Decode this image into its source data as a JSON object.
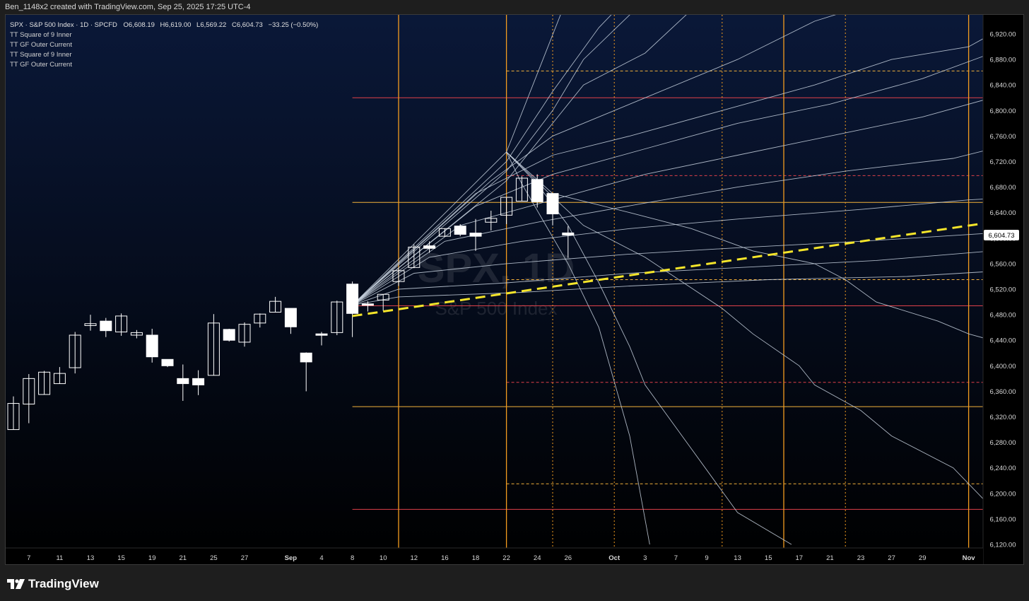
{
  "header": {
    "title": "Ben_1148x2 created with TradingView.com, Sep 25, 2025 17:25 UTC-4"
  },
  "legend": {
    "symbol": "SPX · S&P 500 Index · 1D · SPCFD",
    "open_label": "O",
    "open": "6,608.19",
    "high_label": "H",
    "high": "6,619.00",
    "low_label": "L",
    "low": "6,569.22",
    "close_label": "C",
    "close": "6,604.73",
    "change": "−33.25 (−0.50%)",
    "indicators": [
      "TT Square of 9 Inner",
      "TT GF Outer Current",
      "TT Square of 9 Inner",
      "TT GF Outer Current"
    ]
  },
  "watermark": {
    "symbol": "SPX, 1D",
    "name": "S&P 500 Index"
  },
  "price_badge": "6,604.73",
  "brand": {
    "name": "TradingView",
    "icon": "tradingview-logo-icon"
  },
  "colors": {
    "background_top": "#0a1838",
    "background_bottom": "#000000",
    "candle": "#ffffff",
    "gann_fan": "#c9d3e0",
    "trend_line": "#f5e52a",
    "vline": "#f39c1f",
    "red_level": "#e0414a",
    "orange_level": "#f2b13a"
  },
  "chart_data": {
    "type": "candlestick",
    "y_axis": {
      "min": 6120,
      "max": 6940,
      "ticks": [
        "6,920.00",
        "6,880.00",
        "6,840.00",
        "6,800.00",
        "6,760.00",
        "6,720.00",
        "6,680.00",
        "6,640.00",
        "6,600.00",
        "6,560.00",
        "6,520.00",
        "6,480.00",
        "6,440.00",
        "6,400.00",
        "6,360.00",
        "6,320.00",
        "6,280.00",
        "6,240.00",
        "6,200.00",
        "6,160.00",
        "6,120.00"
      ]
    },
    "x_axis": {
      "labels": [
        {
          "label": "7",
          "i": 1
        },
        {
          "label": "11",
          "i": 3
        },
        {
          "label": "13",
          "i": 5
        },
        {
          "label": "15",
          "i": 7
        },
        {
          "label": "19",
          "i": 9
        },
        {
          "label": "21",
          "i": 11
        },
        {
          "label": "25",
          "i": 13
        },
        {
          "label": "27",
          "i": 15
        },
        {
          "label": "Sep",
          "i": 18
        },
        {
          "label": "4",
          "i": 20
        },
        {
          "label": "8",
          "i": 22
        },
        {
          "label": "10",
          "i": 24
        },
        {
          "label": "12",
          "i": 26
        },
        {
          "label": "16",
          "i": 28
        },
        {
          "label": "18",
          "i": 30
        },
        {
          "label": "22",
          "i": 32
        },
        {
          "label": "24",
          "i": 34
        },
        {
          "label": "26",
          "i": 36
        },
        {
          "label": "Oct",
          "i": 39
        },
        {
          "label": "3",
          "i": 41
        },
        {
          "label": "7",
          "i": 43
        },
        {
          "label": "9",
          "i": 45
        },
        {
          "label": "13",
          "i": 47
        },
        {
          "label": "15",
          "i": 49
        },
        {
          "label": "17",
          "i": 51
        },
        {
          "label": "21",
          "i": 53
        },
        {
          "label": "23",
          "i": 55
        },
        {
          "label": "27",
          "i": 57
        },
        {
          "label": "29",
          "i": 59
        },
        {
          "label": "Nov",
          "i": 62
        }
      ]
    },
    "candles": [
      {
        "d": "Aug 5",
        "o": 6300,
        "h": 6352,
        "l": 6300,
        "c": 6341
      },
      {
        "d": "Aug 6",
        "o": 6340,
        "h": 6387,
        "l": 6310,
        "c": 6380
      },
      {
        "d": "Aug 7",
        "o": 6355,
        "h": 6392,
        "l": 6355,
        "c": 6390
      },
      {
        "d": "Aug 8",
        "o": 6372,
        "h": 6398,
        "l": 6372,
        "c": 6388
      },
      {
        "d": "Aug 11",
        "o": 6397,
        "h": 6453,
        "l": 6388,
        "c": 6448
      },
      {
        "d": "Aug 12",
        "o": 6463,
        "h": 6480,
        "l": 6455,
        "c": 6466
      },
      {
        "d": "Aug 13",
        "o": 6470,
        "h": 6475,
        "l": 6445,
        "c": 6455
      },
      {
        "d": "Aug 14",
        "o": 6453,
        "h": 6482,
        "l": 6447,
        "c": 6478
      },
      {
        "d": "Aug 15",
        "o": 6448,
        "h": 6456,
        "l": 6443,
        "c": 6452
      },
      {
        "d": "Aug 18",
        "o": 6448,
        "h": 6458,
        "l": 6405,
        "c": 6414
      },
      {
        "d": "Aug 19",
        "o": 6410,
        "h": 6410,
        "l": 6398,
        "c": 6400
      },
      {
        "d": "Aug 20",
        "o": 6380,
        "h": 6402,
        "l": 6345,
        "c": 6372
      },
      {
        "d": "Aug 21",
        "o": 6380,
        "h": 6393,
        "l": 6354,
        "c": 6370
      },
      {
        "d": "Aug 22",
        "o": 6385,
        "h": 6481,
        "l": 6385,
        "c": 6467
      },
      {
        "d": "Aug 25",
        "o": 6457,
        "h": 6458,
        "l": 6438,
        "c": 6440
      },
      {
        "d": "Aug 26",
        "o": 6437,
        "h": 6468,
        "l": 6430,
        "c": 6465
      },
      {
        "d": "Aug 27",
        "o": 6467,
        "h": 6482,
        "l": 6460,
        "c": 6481
      },
      {
        "d": "Aug 28",
        "o": 6484,
        "h": 6508,
        "l": 6484,
        "c": 6501
      },
      {
        "d": "Aug 29",
        "o": 6490,
        "h": 6490,
        "l": 6450,
        "c": 6461
      },
      {
        "d": "Sep 2",
        "o": 6420,
        "h": 6421,
        "l": 6360,
        "c": 6406
      },
      {
        "d": "Sep 3",
        "o": 6450,
        "h": 6453,
        "l": 6432,
        "c": 6449
      },
      {
        "d": "Sep 4",
        "o": 6452,
        "h": 6502,
        "l": 6448,
        "c": 6500
      },
      {
        "d": "Sep 5",
        "o": 6528,
        "h": 6532,
        "l": 6445,
        "c": 6482
      },
      {
        "d": "Sep 8",
        "o": 6497,
        "h": 6501,
        "l": 6485,
        "c": 6495
      },
      {
        "d": "Sep 9",
        "o": 6503,
        "h": 6512,
        "l": 6486,
        "c": 6512
      },
      {
        "d": "Sep 10",
        "o": 6532,
        "h": 6552,
        "l": 6525,
        "c": 6549
      },
      {
        "d": "Sep 11",
        "o": 6554,
        "h": 6590,
        "l": 6553,
        "c": 6586
      },
      {
        "d": "Sep 12",
        "o": 6588,
        "h": 6595,
        "l": 6577,
        "c": 6584
      },
      {
        "d": "Sep 15",
        "o": 6603,
        "h": 6615,
        "l": 6602,
        "c": 6615
      },
      {
        "d": "Sep 16",
        "o": 6619,
        "h": 6622,
        "l": 6603,
        "c": 6606
      },
      {
        "d": "Sep 17",
        "o": 6608,
        "h": 6630,
        "l": 6580,
        "c": 6603
      },
      {
        "d": "Sep 18",
        "o": 6625,
        "h": 6643,
        "l": 6612,
        "c": 6631
      },
      {
        "d": "Sep 19",
        "o": 6636,
        "h": 6663,
        "l": 6622,
        "c": 6664
      },
      {
        "d": "Sep 22",
        "o": 6658,
        "h": 6697,
        "l": 6658,
        "c": 6694
      },
      {
        "d": "Sep 23",
        "o": 6692,
        "h": 6700,
        "l": 6648,
        "c": 6657
      },
      {
        "d": "Sep 24",
        "o": 6670,
        "h": 6670,
        "l": 6620,
        "c": 6638
      },
      {
        "d": "Sep 25",
        "o": 6608.19,
        "h": 6619,
        "l": 6569.22,
        "c": 6604.73
      }
    ],
    "levels": [
      {
        "price": 6820,
        "color": "red",
        "style": "solid",
        "from_i": 22
      },
      {
        "price": 6656,
        "color": "orange",
        "style": "solid",
        "from_i": 22
      },
      {
        "price": 6494,
        "color": "red",
        "style": "solid",
        "from_i": 22
      },
      {
        "price": 6336,
        "color": "orange",
        "style": "solid",
        "from_i": 22
      },
      {
        "price": 6175,
        "color": "red",
        "style": "solid",
        "from_i": 22
      },
      {
        "price": 6862,
        "color": "orange",
        "style": "dashed",
        "from_i": 32
      },
      {
        "price": 6698,
        "color": "red",
        "style": "dashed",
        "from_i": 32
      },
      {
        "price": 6535,
        "color": "orange",
        "style": "dashed",
        "from_i": 32
      },
      {
        "price": 6374,
        "color": "red",
        "style": "dashed",
        "from_i": 32
      },
      {
        "price": 6215,
        "color": "orange",
        "style": "dashed",
        "from_i": 32
      }
    ],
    "vlines": [
      {
        "i": 25,
        "style": "solid"
      },
      {
        "i": 32,
        "style": "solid"
      },
      {
        "i": 35,
        "style": "dotted"
      },
      {
        "i": 39,
        "style": "dotted"
      },
      {
        "i": 46,
        "style": "dotted"
      },
      {
        "i": 50,
        "style": "solid"
      },
      {
        "i": 54,
        "style": "dotted"
      },
      {
        "i": 62,
        "style": "solid"
      }
    ],
    "trend_line": {
      "from": {
        "i": 22,
        "p": 6478
      },
      "to": {
        "i": 63.5,
        "p": 6625
      }
    },
    "fan_origin": {
      "i": 22,
      "p": 6495
    },
    "fan_lines": [
      [
        [
          22,
          6495
        ],
        [
          32,
          6735
        ],
        [
          36,
          6980
        ]
      ],
      [
        [
          22,
          6495
        ],
        [
          32,
          6720
        ],
        [
          35,
          6830
        ],
        [
          38,
          6930
        ],
        [
          40,
          6980
        ]
      ],
      [
        [
          22,
          6495
        ],
        [
          32,
          6705
        ],
        [
          35,
          6800
        ],
        [
          37,
          6880
        ],
        [
          40,
          6950
        ],
        [
          42,
          6980
        ]
      ],
      [
        [
          22,
          6495
        ],
        [
          32,
          6690
        ],
        [
          35,
          6780
        ],
        [
          37,
          6840
        ],
        [
          41,
          6890
        ],
        [
          45,
          6980
        ]
      ],
      [
        [
          22,
          6495
        ],
        [
          31,
          6690
        ],
        [
          35,
          6760
        ],
        [
          41,
          6820
        ],
        [
          47,
          6880
        ],
        [
          52,
          6940
        ],
        [
          56,
          6970
        ],
        [
          60,
          6980
        ]
      ],
      [
        [
          22,
          6495
        ],
        [
          30,
          6670
        ],
        [
          35,
          6730
        ],
        [
          40,
          6760
        ],
        [
          46,
          6800
        ],
        [
          52,
          6840
        ],
        [
          57,
          6880
        ],
        [
          62,
          6900
        ],
        [
          63.5,
          6920
        ]
      ],
      [
        [
          22,
          6495
        ],
        [
          30,
          6650
        ],
        [
          35,
          6700
        ],
        [
          41,
          6740
        ],
        [
          47,
          6780
        ],
        [
          53,
          6810
        ],
        [
          59,
          6850
        ],
        [
          63.5,
          6890
        ]
      ],
      [
        [
          22,
          6495
        ],
        [
          29,
          6620
        ],
        [
          35,
          6660
        ],
        [
          41,
          6700
        ],
        [
          47,
          6730
        ],
        [
          53,
          6760
        ],
        [
          59,
          6790
        ],
        [
          63.5,
          6820
        ]
      ],
      [
        [
          22,
          6495
        ],
        [
          28,
          6595
        ],
        [
          34,
          6625
        ],
        [
          41,
          6655
        ],
        [
          47,
          6680
        ],
        [
          54,
          6705
        ],
        [
          61,
          6725
        ],
        [
          63.5,
          6740
        ]
      ],
      [
        [
          22,
          6495
        ],
        [
          27,
          6570
        ],
        [
          33,
          6595
        ],
        [
          40,
          6615
        ],
        [
          47,
          6630
        ],
        [
          55,
          6645
        ],
        [
          62,
          6660
        ],
        [
          63.5,
          6662
        ]
      ],
      [
        [
          22,
          6495
        ],
        [
          26,
          6545
        ],
        [
          32,
          6560
        ],
        [
          40,
          6575
        ],
        [
          47,
          6585
        ],
        [
          55,
          6595
        ],
        [
          63.5,
          6608
        ]
      ],
      [
        [
          22,
          6495
        ],
        [
          25,
          6520
        ],
        [
          32,
          6530
        ],
        [
          40,
          6545
        ],
        [
          48,
          6555
        ],
        [
          56,
          6565
        ],
        [
          63.5,
          6580
        ]
      ],
      [
        [
          22,
          6495
        ],
        [
          25,
          6508
        ],
        [
          33,
          6515
        ],
        [
          40,
          6525
        ],
        [
          49,
          6535
        ],
        [
          58,
          6540
        ],
        [
          63.5,
          6548
        ]
      ],
      [
        [
          32,
          6735
        ],
        [
          33,
          6685
        ],
        [
          36,
          6560
        ],
        [
          38,
          6460
        ],
        [
          40,
          6290
        ],
        [
          41.3,
          6120
        ]
      ],
      [
        [
          32,
          6735
        ],
        [
          34,
          6685
        ],
        [
          36,
          6620
        ],
        [
          38,
          6530
        ],
        [
          40,
          6430
        ],
        [
          41,
          6370
        ],
        [
          44,
          6270
        ],
        [
          47,
          6170
        ],
        [
          50.5,
          6120
        ]
      ],
      [
        [
          32,
          6735
        ],
        [
          35,
          6665
        ],
        [
          37,
          6620
        ],
        [
          41,
          6570
        ],
        [
          46,
          6490
        ],
        [
          48,
          6450
        ],
        [
          51,
          6400
        ],
        [
          52,
          6370
        ],
        [
          55,
          6330
        ],
        [
          57,
          6290
        ],
        [
          61,
          6240
        ],
        [
          63,
          6190
        ]
      ],
      [
        [
          32,
          6735
        ],
        [
          35,
          6670
        ],
        [
          40,
          6640
        ],
        [
          44,
          6615
        ],
        [
          48,
          6580
        ],
        [
          52,
          6560
        ],
        [
          54,
          6535
        ],
        [
          56,
          6500
        ],
        [
          60,
          6470
        ],
        [
          62,
          6450
        ],
        [
          63.5,
          6440
        ]
      ]
    ]
  }
}
